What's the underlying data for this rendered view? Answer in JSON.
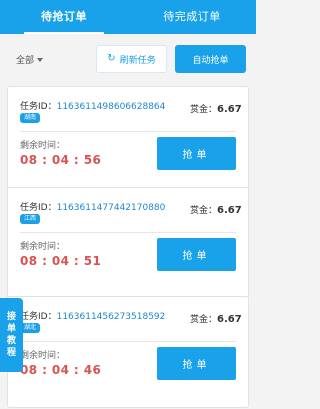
{
  "tabs": {
    "pending": "待抢订单",
    "done": "待完成订单"
  },
  "filter": {
    "label": "全部"
  },
  "actions": {
    "refresh": "刷新任务",
    "auto_grab": "自动抢单"
  },
  "tasks": [
    {
      "prefix": "任务ID：",
      "id": "1163611498606628864",
      "region": "湖南",
      "bounty_label": "赏金：",
      "bounty": "6.67",
      "remain_label": "剩余时间：",
      "timer": "08 : 04 : 56",
      "button": "抢单"
    },
    {
      "prefix": "任务ID：",
      "id": "1163611477442170880",
      "region": "江西",
      "bounty_label": "赏金：",
      "bounty": "6.67",
      "remain_label": "剩余时间：",
      "timer": "08 : 04 : 51",
      "button": "抢单"
    },
    {
      "prefix": "任务ID：",
      "id": "1163611456273518592",
      "region": "湖北",
      "bounty_label": "赏金：",
      "bounty": "6.67",
      "remain_label": "剩余时间：",
      "timer": "08 : 04 : 46",
      "button": "抢单"
    }
  ],
  "side_tab": {
    "chars": [
      "接",
      "单",
      "教",
      "程"
    ]
  }
}
